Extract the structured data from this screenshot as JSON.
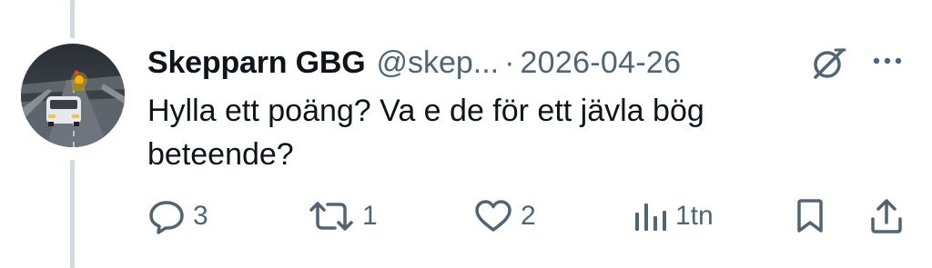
{
  "tweet": {
    "display_name": "Skepparn GBG",
    "handle": "@skep...",
    "separator": "·",
    "date": "2026-04-26",
    "text": "Hylla ett poäng? Va e de för ett jävla bög beteende?"
  },
  "actions": {
    "reply": {
      "icon": "reply-icon",
      "count": "3"
    },
    "retweet": {
      "icon": "retweet-icon",
      "count": "1"
    },
    "like": {
      "icon": "heart-icon",
      "count": "2"
    },
    "views": {
      "icon": "views-chart-icon",
      "count": "1tn"
    },
    "bookmark": {
      "icon": "bookmark-icon"
    },
    "share": {
      "icon": "share-icon"
    }
  },
  "header_icons": {
    "grok": "grok-icon",
    "more": "more-options-icon"
  },
  "colors": {
    "text_primary": "#0f1419",
    "text_secondary": "#536471",
    "thread_line": "#cfd9de",
    "background": "#ffffff"
  }
}
